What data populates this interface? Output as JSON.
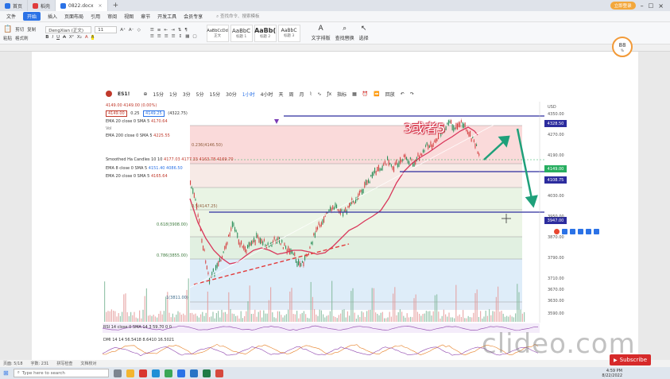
{
  "tabs": [
    {
      "label": "首页",
      "active": false,
      "color": "#2b72e6"
    },
    {
      "label": "稻壳",
      "active": false,
      "color": "#e03c3c"
    },
    {
      "label": "0822.docx",
      "active": true,
      "color": "#2b72e6"
    }
  ],
  "user_badge": "立即登录",
  "menu": [
    "文件",
    "开始",
    "插入",
    "页面布局",
    "引用",
    "审阅",
    "视图",
    "章节",
    "开发工具",
    "会员专享",
    "查找命令、搜索模板"
  ],
  "menu_active": "开始",
  "ribbon": {
    "font_name": "DengXian (正文)",
    "font_size": "11",
    "paste": "粘贴",
    "cut": "剪切",
    "copy": "复制",
    "format_painter": "格式刷",
    "styles": [
      {
        "preview": "AaBbCcDd",
        "label": "正文"
      },
      {
        "preview": "AaBbC",
        "label": "标题 1"
      },
      {
        "preview": "AaBb(",
        "label": "标题 2"
      },
      {
        "preview": "AaBbC",
        "label": "标题 3"
      }
    ],
    "text_layout": "文字排版",
    "find_replace": "查找替换",
    "select": "选择"
  },
  "zoom_badge": {
    "value": "88",
    "unit": "%"
  },
  "chart": {
    "symbol": "ES1!",
    "timeframes": [
      "15分",
      "1分",
      "3分",
      "5分",
      "15分",
      "30分",
      "1小时",
      "4小时",
      "天",
      "周",
      "月"
    ],
    "timeframe_active": "1小时",
    "indicators_btn": "指标",
    "replay_btn": "回放",
    "annotation": "3或者5",
    "price_top_left": "4149.00  4149.00 (0.00%)",
    "price_box_1": "4149.00",
    "price_box_1b": "0.25",
    "price_box_2": "4149.25",
    "price_box_2b": "(4322.75)",
    "ind_ema20": {
      "label": "EMA 20 close 0 SMA 5",
      "value": "4170.64"
    },
    "ind_vol": "Vol",
    "ind_ema200": {
      "label": "EMA 200 close 0 SMA 5",
      "value": "4225.55"
    },
    "ind_fib1": "0.236(4146.50)",
    "ind_fib2": "0.5(4147.25)",
    "ind_smooth": {
      "label": "Smoothed Ha Candles 10 10",
      "values": [
        "4177.03",
        "4177.33",
        "4163.78",
        "4169.70"
      ]
    },
    "ind_ema8": {
      "label": "EMA 8 close 0 SMA 5",
      "values": [
        "4151.40",
        "4086.50"
      ]
    },
    "ind_ema20b": {
      "label": "EMA 20 close 0 SMA 5",
      "value": "4165.64"
    },
    "fib_618": "0.618(3908.00)",
    "fib_786": "0.786(3855.00)",
    "fib_1": "1(3811.00)",
    "tags": [
      {
        "text": "4328.50",
        "color": "#2c2c9e"
      },
      {
        "text": "4149.00",
        "color": "#27ae60"
      },
      {
        "text": "4108.75",
        "color": "#2c2c9e"
      },
      {
        "text": "3947.00",
        "color": "#2c2c9e"
      }
    ],
    "axis_ticks": [
      "4350.00",
      "4270.00",
      "4190.00",
      "4030.00",
      "3950.00",
      "3870.00",
      "3790.00",
      "3710.00",
      "3670.00",
      "3630.00",
      "3590.00"
    ],
    "currency": "USD",
    "osc1_label": "RSI 14 close 0 SMA 14 3   59.70   0   0",
    "osc2_label": "DMI 14 14   56.5418   8.6410   16.5021"
  },
  "status_bar": {
    "page": "页面: 5/18",
    "words": "字数: 231",
    "spell": "拼写检查",
    "compat": "文档校对"
  },
  "taskbar": {
    "search": "Type here to search",
    "clock_time": "4:59 PM",
    "clock_date": "8/22/2022"
  },
  "watermark": "clideo.com",
  "subscribe": "Subscribe"
}
